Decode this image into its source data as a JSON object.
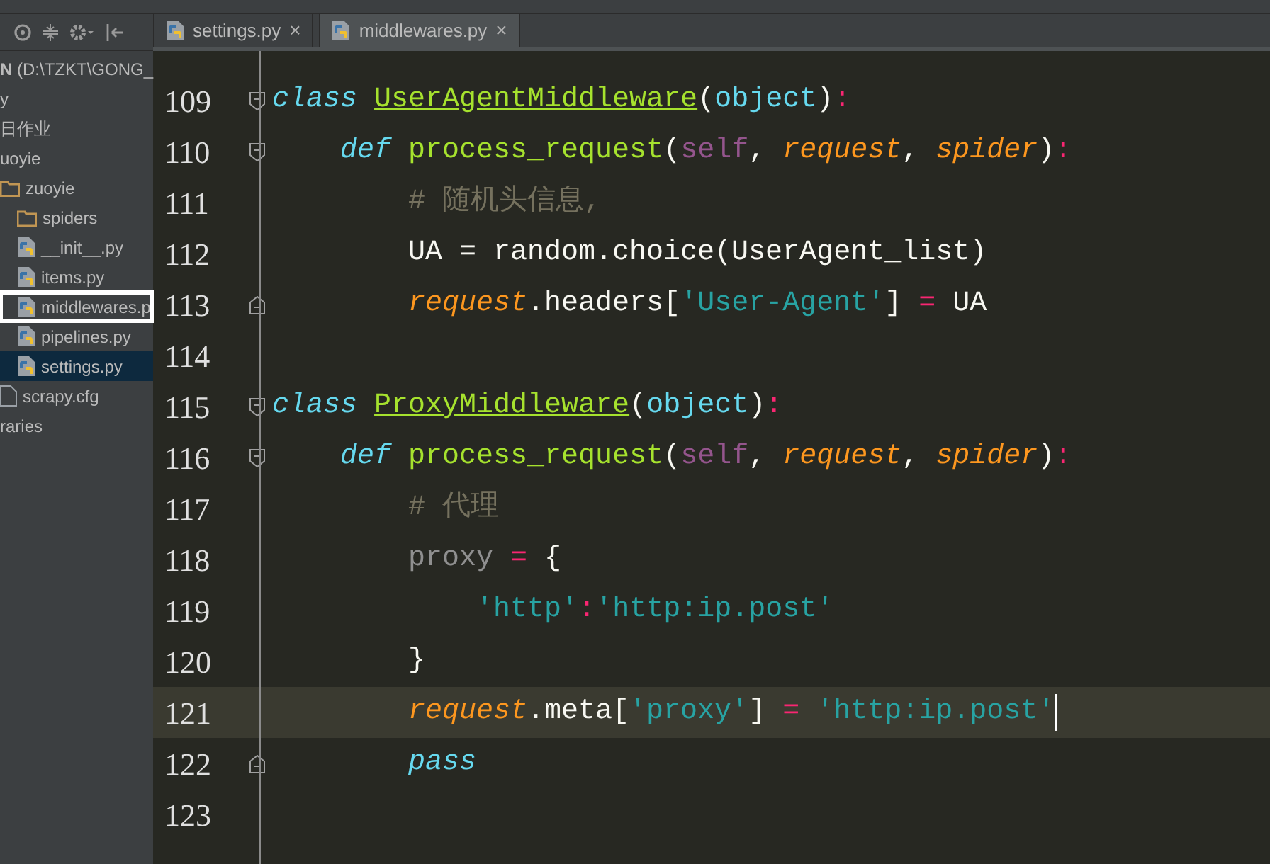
{
  "project_tree": [
    {
      "label": "**N** (D:\\TZKT\\GONG_",
      "selected": false,
      "focused": false
    },
    {
      "label": "y",
      "selected": false,
      "focused": false
    },
    {
      "label": "日作业",
      "selected": false,
      "focused": false
    },
    {
      "label": "uoyie",
      "selected": false,
      "focused": false,
      "children": [
        {
          "label": "zuoyie",
          "kind": "folder",
          "selected": false,
          "focused": false,
          "children": [
            {
              "label": "spiders",
              "kind": "folder",
              "selected": false,
              "focused": false
            },
            {
              "label": "__init__.py",
              "kind": "python",
              "selected": false,
              "focused": false
            },
            {
              "label": "items.py",
              "kind": "python",
              "selected": false,
              "focused": false
            },
            {
              "label": "middlewares.p",
              "kind": "python",
              "selected": false,
              "focused": true
            },
            {
              "label": "pipelines.py",
              "kind": "python",
              "selected": false,
              "focused": false
            },
            {
              "label": "settings.py",
              "kind": "python",
              "selected": true,
              "focused": false
            }
          ]
        },
        {
          "label": "scrapy.cfg",
          "kind": "file",
          "selected": false,
          "focused": false
        }
      ]
    },
    {
      "label": "raries",
      "selected": false,
      "focused": false
    }
  ],
  "tabs": [
    {
      "label": "settings.py",
      "close": "×",
      "selected": false
    },
    {
      "label": "middlewares.py",
      "close": "×",
      "selected": true
    }
  ],
  "editor": {
    "lines": [
      {
        "number": "109",
        "fold_start": true,
        "fold_end": false,
        "current": false,
        "tokens": [
          {
            "text": "class ",
            "kind": "keyword"
          },
          {
            "text": "UserAgentMiddleware",
            "kind": "classname"
          },
          {
            "text": "(",
            "kind": "plain"
          },
          {
            "text": "object",
            "kind": "builtin"
          },
          {
            "text": ")",
            "kind": "plain"
          },
          {
            "text": ":",
            "kind": "operator"
          }
        ]
      },
      {
        "number": "110",
        "fold_start": true,
        "fold_end": false,
        "current": false,
        "tokens": [
          {
            "text": "    def ",
            "kind": "keyword"
          },
          {
            "text": "process_request",
            "kind": "funcname"
          },
          {
            "text": "(",
            "kind": "plain"
          },
          {
            "text": "self",
            "kind": "self"
          },
          {
            "text": ", ",
            "kind": "plain"
          },
          {
            "text": "request",
            "kind": "param"
          },
          {
            "text": ", ",
            "kind": "plain"
          },
          {
            "text": "spider",
            "kind": "param"
          },
          {
            "text": ")",
            "kind": "plain"
          },
          {
            "text": ":",
            "kind": "operator"
          }
        ]
      },
      {
        "number": "111",
        "fold_start": false,
        "fold_end": false,
        "current": false,
        "tokens": [
          {
            "text": "        # 随机头信息,",
            "kind": "comment"
          }
        ]
      },
      {
        "number": "112",
        "fold_start": false,
        "fold_end": false,
        "current": false,
        "tokens": [
          {
            "text": "        UA = random.choice(UserAgent_list)",
            "kind": "plain"
          }
        ]
      },
      {
        "number": "113",
        "fold_start": false,
        "fold_end": true,
        "current": false,
        "tokens": [
          {
            "text": "        request",
            "kind": "param"
          },
          {
            "text": ".headers[",
            "kind": "plain"
          },
          {
            "text": "'User-Agent'",
            "kind": "string"
          },
          {
            "text": "] ",
            "kind": "plain"
          },
          {
            "text": "=",
            "kind": "operator"
          },
          {
            "text": " UA",
            "kind": "plain"
          }
        ]
      },
      {
        "number": "114",
        "fold_start": false,
        "fold_end": false,
        "current": false
      },
      {
        "number": "115",
        "fold_start": true,
        "fold_end": false,
        "current": false,
        "tokens": [
          {
            "text": "class ",
            "kind": "keyword"
          },
          {
            "text": "ProxyMiddleware",
            "kind": "classname"
          },
          {
            "text": "(",
            "kind": "plain"
          },
          {
            "text": "object",
            "kind": "builtin"
          },
          {
            "text": ")",
            "kind": "plain"
          },
          {
            "text": ":",
            "kind": "operator"
          }
        ]
      },
      {
        "number": "116",
        "fold_start": true,
        "fold_end": false,
        "current": false,
        "tokens": [
          {
            "text": "    def ",
            "kind": "keyword"
          },
          {
            "text": "process_request",
            "kind": "funcname"
          },
          {
            "text": "(",
            "kind": "plain"
          },
          {
            "text": "self",
            "kind": "self"
          },
          {
            "text": ", ",
            "kind": "plain"
          },
          {
            "text": "request",
            "kind": "param"
          },
          {
            "text": ", ",
            "kind": "plain"
          },
          {
            "text": "spider",
            "kind": "param"
          },
          {
            "text": ")",
            "kind": "plain"
          },
          {
            "text": ":",
            "kind": "operator"
          }
        ]
      },
      {
        "number": "117",
        "fold_start": false,
        "fold_end": false,
        "current": false,
        "tokens": [
          {
            "text": "        # 代理",
            "kind": "comment"
          }
        ]
      },
      {
        "number": "118",
        "fold_start": false,
        "fold_end": false,
        "current": false,
        "tokens": [
          {
            "text": "        proxy",
            "kind": "unused"
          },
          {
            "text": " = ",
            "kind": "operator"
          },
          {
            "text": "{",
            "kind": "plain"
          }
        ]
      },
      {
        "number": "119",
        "fold_start": false,
        "fold_end": false,
        "current": false,
        "tokens": [
          {
            "text": "            'http'",
            "kind": "string"
          },
          {
            "text": ":",
            "kind": "operator"
          },
          {
            "text": "'http:ip.post'",
            "kind": "string"
          }
        ]
      },
      {
        "number": "120",
        "fold_start": false,
        "fold_end": false,
        "current": false,
        "tokens": [
          {
            "text": "        }",
            "kind": "plain"
          }
        ]
      },
      {
        "number": "121",
        "fold_start": false,
        "fold_end": false,
        "current": true,
        "tokens": [
          {
            "text": "        request",
            "kind": "param"
          },
          {
            "text": ".meta[",
            "kind": "plain"
          },
          {
            "text": "'proxy'",
            "kind": "string"
          },
          {
            "text": "] ",
            "kind": "plain"
          },
          {
            "text": "= ",
            "kind": "operator"
          },
          {
            "text": "'http:ip.post'",
            "kind": "string"
          }
        ]
      },
      {
        "number": "122",
        "fold_start": false,
        "fold_end": true,
        "current": false,
        "tokens": [
          {
            "text": "        pass",
            "kind": "keyword"
          }
        ]
      },
      {
        "number": "123",
        "fold_start": false,
        "fold_end": false,
        "current": false
      }
    ]
  }
}
